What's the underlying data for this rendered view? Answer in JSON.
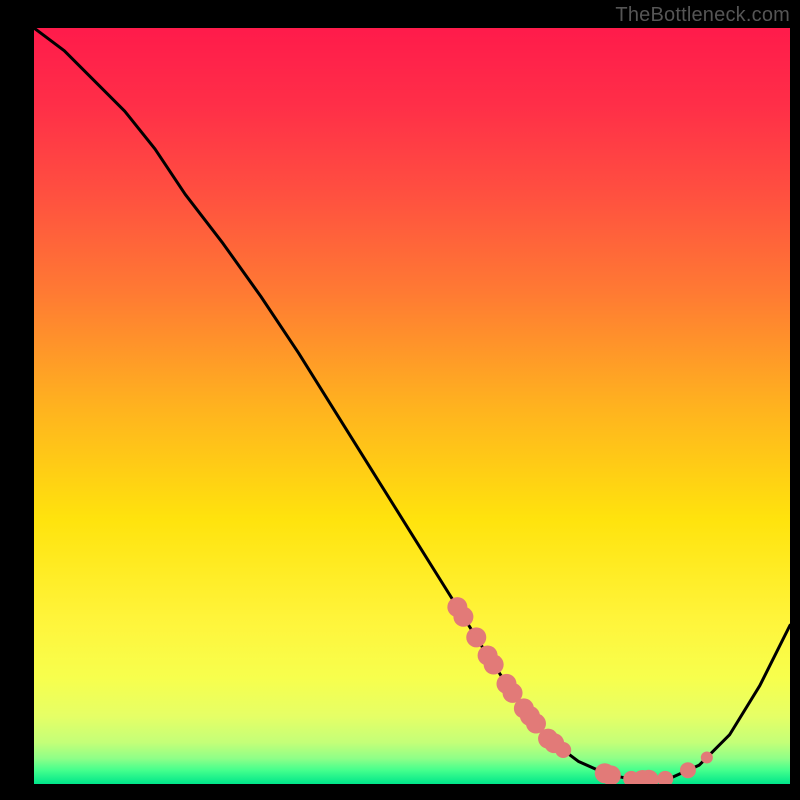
{
  "attribution": "TheBottleneck.com",
  "gradient": {
    "stops": [
      {
        "offset": 0.0,
        "color": "#ff1b4b"
      },
      {
        "offset": 0.1,
        "color": "#ff2e48"
      },
      {
        "offset": 0.22,
        "color": "#ff5040"
      },
      {
        "offset": 0.35,
        "color": "#ff7a33"
      },
      {
        "offset": 0.5,
        "color": "#ffb21f"
      },
      {
        "offset": 0.65,
        "color": "#ffe30d"
      },
      {
        "offset": 0.78,
        "color": "#fff43a"
      },
      {
        "offset": 0.86,
        "color": "#f7ff4d"
      },
      {
        "offset": 0.91,
        "color": "#e6ff66"
      },
      {
        "offset": 0.945,
        "color": "#c4ff78"
      },
      {
        "offset": 0.966,
        "color": "#8fff88"
      },
      {
        "offset": 0.982,
        "color": "#44ff8d"
      },
      {
        "offset": 1.0,
        "color": "#00e58a"
      }
    ]
  },
  "chart_data": {
    "type": "line",
    "title": "",
    "xlabel": "",
    "ylabel": "",
    "xlim": [
      0,
      100
    ],
    "ylim": [
      0,
      100
    ],
    "series": [
      {
        "name": "bottleneck-curve",
        "x": [
          0,
          4,
          8,
          12,
          16,
          20,
          25,
          30,
          35,
          40,
          45,
          50,
          55,
          60,
          64,
          68,
          72,
          76,
          80,
          84,
          88,
          92,
          96,
          100
        ],
        "y": [
          100,
          97,
          93,
          89,
          84,
          78,
          71.5,
          64.5,
          57,
          49,
          41,
          33,
          25,
          17,
          11,
          6,
          3,
          1.2,
          0.5,
          0.7,
          2.5,
          6.5,
          13,
          21
        ]
      }
    ],
    "markers": {
      "name": "highlighted-points",
      "color": "#e27a78",
      "points": [
        {
          "x": 56.0,
          "r": 10
        },
        {
          "x": 56.8,
          "r": 10
        },
        {
          "x": 58.5,
          "r": 10
        },
        {
          "x": 60.0,
          "r": 10
        },
        {
          "x": 60.8,
          "r": 10
        },
        {
          "x": 62.5,
          "r": 10
        },
        {
          "x": 63.3,
          "r": 10
        },
        {
          "x": 64.8,
          "r": 10
        },
        {
          "x": 65.6,
          "r": 10
        },
        {
          "x": 66.4,
          "r": 10
        },
        {
          "x": 68.0,
          "r": 10
        },
        {
          "x": 68.8,
          "r": 10
        },
        {
          "x": 70.0,
          "r": 8
        },
        {
          "x": 75.5,
          "r": 10
        },
        {
          "x": 76.3,
          "r": 10
        },
        {
          "x": 79.0,
          "r": 8
        },
        {
          "x": 80.5,
          "r": 10
        },
        {
          "x": 81.3,
          "r": 10
        },
        {
          "x": 83.5,
          "r": 8
        },
        {
          "x": 86.5,
          "r": 8
        },
        {
          "x": 89.0,
          "r": 6
        }
      ]
    }
  }
}
